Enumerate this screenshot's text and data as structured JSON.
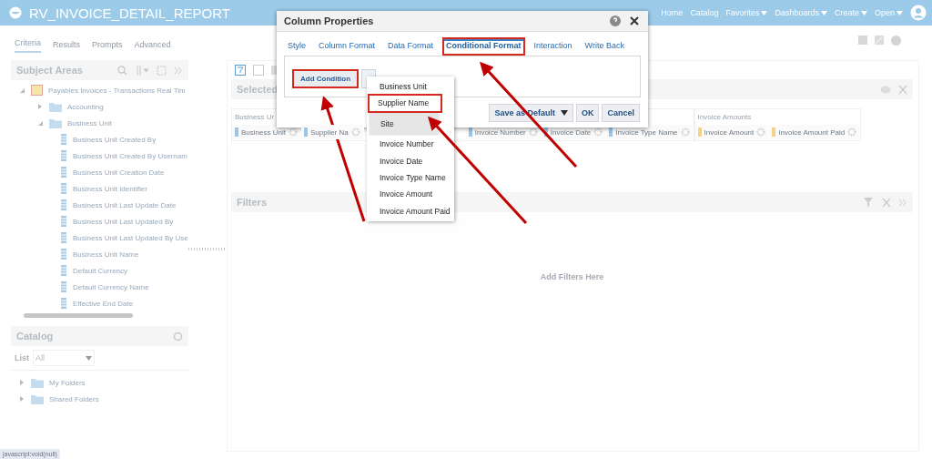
{
  "header": {
    "title": "RV_INVOICE_DETAIL_REPORT",
    "nav": [
      {
        "label": "Home",
        "menu": false
      },
      {
        "label": "Catalog",
        "menu": false
      },
      {
        "label": "Favorites",
        "menu": true
      },
      {
        "label": "Dashboards",
        "menu": true
      },
      {
        "label": "Create",
        "menu": true
      },
      {
        "label": "Open",
        "menu": true
      }
    ]
  },
  "tabs": [
    {
      "label": "Criteria",
      "selected": true
    },
    {
      "label": "Results",
      "selected": false
    },
    {
      "label": "Prompts",
      "selected": false
    },
    {
      "label": "Advanced",
      "selected": false
    }
  ],
  "subject_areas": {
    "title": "Subject Areas",
    "tree": [
      {
        "label": "Payables Invoices - Transactions Real Tim",
        "kind": "subject",
        "expanded": true,
        "children": [
          {
            "label": "Accounting",
            "kind": "folder",
            "expanded": false
          },
          {
            "label": "Business Unit",
            "kind": "folder",
            "expanded": true,
            "children": [
              {
                "label": "Business Unit Created By",
                "kind": "column"
              },
              {
                "label": "Business Unit Created By Usernam",
                "kind": "column"
              },
              {
                "label": "Business Unit Creation Date",
                "kind": "column"
              },
              {
                "label": "Business Unit Identifier",
                "kind": "column"
              },
              {
                "label": "Business Unit Last Update Date",
                "kind": "column"
              },
              {
                "label": "Business Unit Last Updated By",
                "kind": "column"
              },
              {
                "label": "Business Unit Last Updated By Use",
                "kind": "column"
              },
              {
                "label": "Business Unit Name",
                "kind": "column"
              },
              {
                "label": "Default Currency",
                "kind": "column"
              },
              {
                "label": "Default Currency Name",
                "kind": "column"
              },
              {
                "label": "Effective End Date",
                "kind": "column"
              }
            ]
          }
        ]
      }
    ]
  },
  "catalog": {
    "title": "Catalog",
    "list_label": "List",
    "list_value": "All",
    "folders": [
      {
        "label": "My Folders",
        "expanded": false
      },
      {
        "label": "Shared Folders",
        "expanded": false
      }
    ]
  },
  "selected_columns": {
    "title": "Selected",
    "groups": [
      {
        "label": "Business Ur",
        "columns": [
          {
            "label": "Business Unit",
            "kind": "attribute"
          },
          {
            "label": "Supplier Na",
            "kind": "attribute"
          },
          {
            "label": "Invoice Number",
            "kind": "attribute"
          },
          {
            "label": "Invoice Date",
            "kind": "attribute"
          },
          {
            "label": "Invoice Type Name",
            "kind": "attribute"
          }
        ]
      },
      {
        "label": "Invoice Amounts",
        "columns": [
          {
            "label": "Invoice Amount",
            "kind": "measure"
          },
          {
            "label": "Invoice Amount Paid",
            "kind": "measure"
          }
        ]
      }
    ]
  },
  "filters": {
    "title": "Filters",
    "placeholder": "Add Filters Here"
  },
  "dialog": {
    "title": "Column Properties",
    "tabs": [
      {
        "label": "Style",
        "selected": false,
        "highlighted": false
      },
      {
        "label": "Column Format",
        "selected": false,
        "highlighted": false
      },
      {
        "label": "Data Format",
        "selected": false,
        "highlighted": false
      },
      {
        "label": "Conditional Format",
        "selected": true,
        "highlighted": true
      },
      {
        "label": "Interaction",
        "selected": false,
        "highlighted": false
      },
      {
        "label": "Write Back",
        "selected": false,
        "highlighted": false
      }
    ],
    "add_condition": {
      "label": "Add Condition",
      "highlighted": true
    },
    "buttons": [
      {
        "label": "Save as Default",
        "menu": true
      },
      {
        "label": "OK",
        "menu": false
      },
      {
        "label": "Cancel",
        "menu": false
      }
    ]
  },
  "condition_menu": {
    "items": [
      {
        "label": "Business Unit",
        "selected": false,
        "highlighted": false
      },
      {
        "label": "Supplier Name",
        "selected": false,
        "highlighted": true
      },
      {
        "label": "Site",
        "selected": true,
        "highlighted": false
      },
      {
        "label": "Invoice Number",
        "selected": false,
        "highlighted": false
      },
      {
        "label": "Invoice Date",
        "selected": false,
        "highlighted": false
      },
      {
        "label": "Invoice Type Name",
        "selected": false,
        "highlighted": false
      },
      {
        "label": "Invoice Amount",
        "selected": false,
        "highlighted": false
      },
      {
        "label": "Invoice Amount Paid",
        "selected": false,
        "highlighted": false
      }
    ]
  },
  "status_bar": "javascript:void(null)"
}
